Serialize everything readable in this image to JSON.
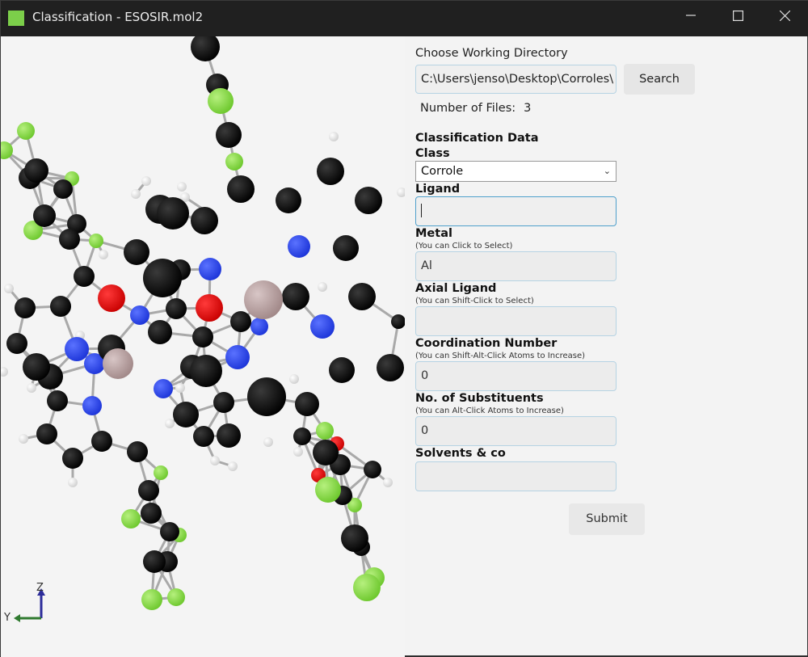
{
  "window": {
    "title": "Classification - ESOSIR.mol2",
    "icon_color": "#7ccf4a"
  },
  "directory": {
    "label": "Choose Working Directory",
    "value": "C:\\Users\\jenso\\Desktop\\Corroles\\",
    "search_label": "Search",
    "files_label": "Number of Files:",
    "files_count": "3"
  },
  "classification": {
    "heading": "Classification Data",
    "class_label": "Class",
    "class_value": "Corrole",
    "ligand_label": "Ligand",
    "ligand_value": "",
    "metal_label": "Metal",
    "metal_hint": "(You can Click to Select)",
    "metal_value": "Al",
    "axial_label": "Axial Ligand",
    "axial_hint": "(You can Shift-Click to Select)",
    "axial_value": "",
    "coord_label": "Coordination Number",
    "coord_hint": "(You can Shift-Alt-Click Atoms to Increase)",
    "coord_value": "0",
    "subst_label": "No. of Substituents",
    "subst_hint": "(You can Alt-Click Atoms to Increase)",
    "subst_value": "0",
    "solvents_label": "Solvents & co",
    "solvents_value": "",
    "submit_label": "Submit"
  },
  "viewer": {
    "axis_z": "Z",
    "axis_y": "Y",
    "atom_colors": {
      "carbon": "#000000",
      "hydrogen": "#ffffff",
      "nitrogen": "#2b48f0",
      "oxygen": "#f00000",
      "fluorine": "#8ee24a",
      "aluminium": "#bca5a5"
    }
  }
}
